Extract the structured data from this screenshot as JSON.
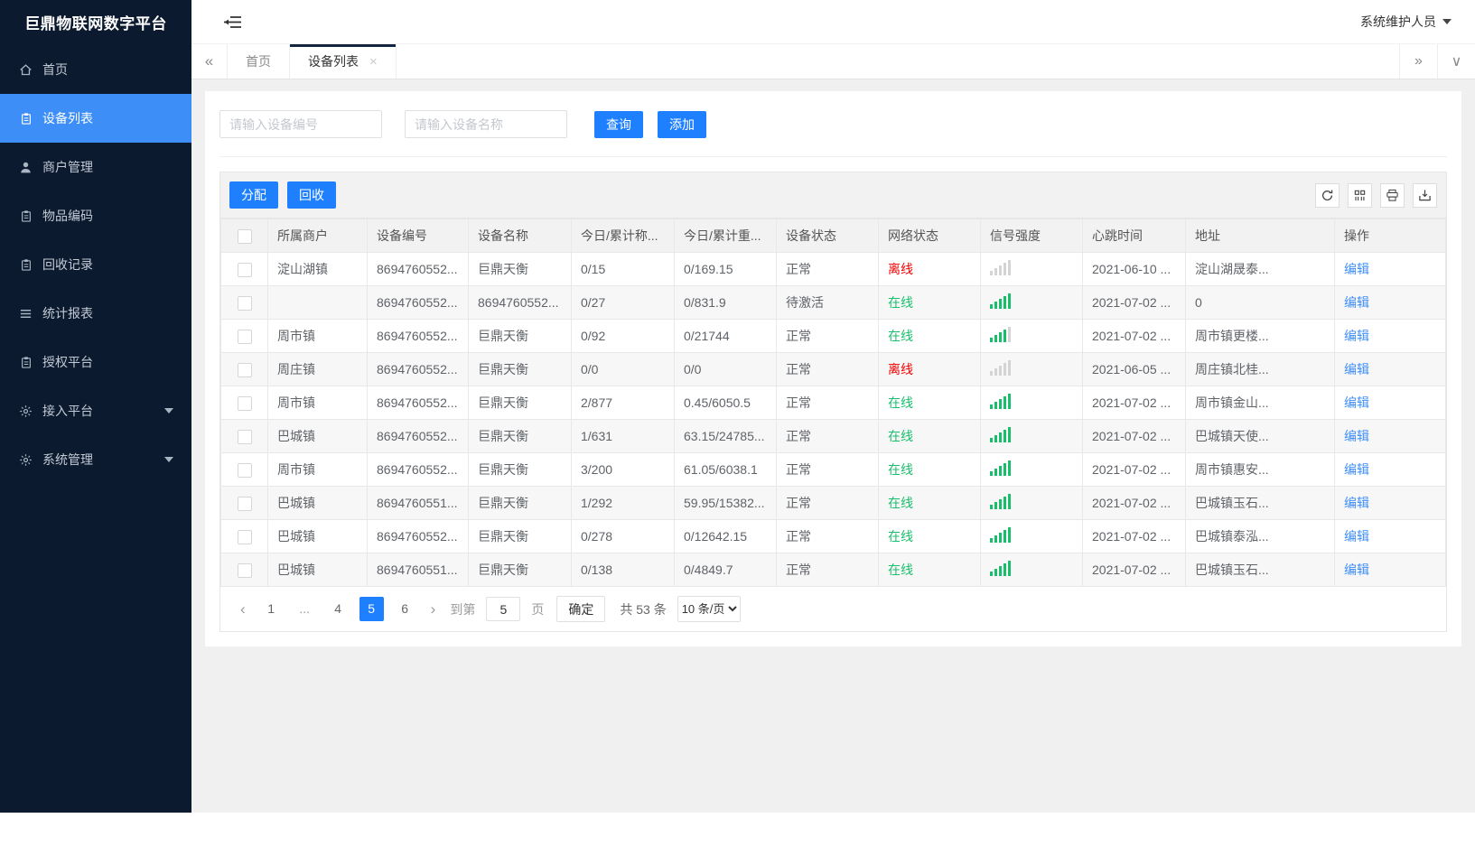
{
  "app": {
    "title": "巨鼎物联网数字平台",
    "user_name": "系统维护人员"
  },
  "icons": {
    "collapse_tabs": "«",
    "expand_tabs": "»",
    "tab_dropdown": "∨",
    "close": "×",
    "pager_prev": "‹",
    "pager_next": "›"
  },
  "sidebar": {
    "items": [
      {
        "key": "home",
        "label": "首页",
        "icon": "home",
        "active": false,
        "caret": false
      },
      {
        "key": "device-list",
        "label": "设备列表",
        "icon": "clipboard",
        "active": true,
        "caret": false
      },
      {
        "key": "merchant-mgmt",
        "label": "商户管理",
        "icon": "user",
        "active": false,
        "caret": false
      },
      {
        "key": "item-code",
        "label": "物品编码",
        "icon": "clipboard",
        "active": false,
        "caret": false
      },
      {
        "key": "recycle-records",
        "label": "回收记录",
        "icon": "clipboard",
        "active": false,
        "caret": false
      },
      {
        "key": "stats-report",
        "label": "统计报表",
        "icon": "list",
        "active": false,
        "caret": false
      },
      {
        "key": "auth-platform",
        "label": "授权平台",
        "icon": "clipboard",
        "active": false,
        "caret": false
      },
      {
        "key": "access-platform",
        "label": "接入平台",
        "icon": "gear",
        "active": false,
        "caret": true
      },
      {
        "key": "system-mgmt",
        "label": "系统管理",
        "icon": "gear",
        "active": false,
        "caret": true
      }
    ]
  },
  "tabs": {
    "items": [
      {
        "label": "首页",
        "active": false
      },
      {
        "label": "设备列表",
        "active": true,
        "closable": true
      }
    ]
  },
  "search": {
    "device_no_placeholder": "请输入设备编号",
    "device_name_placeholder": "请输入设备名称",
    "query_label": "查询",
    "add_label": "添加"
  },
  "toolbar": {
    "assign_label": "分配",
    "recycle_label": "回收",
    "icon_names": [
      "refresh-icon",
      "columns-icon",
      "print-icon",
      "export-icon"
    ]
  },
  "table": {
    "edit_label": "编辑",
    "columns": [
      "所属商户",
      "设备编号",
      "设备名称",
      "今日/累计称...",
      "今日/累计重...",
      "设备状态",
      "网络状态",
      "信号强度",
      "心跳时间",
      "地址",
      "操作"
    ],
    "rows": [
      {
        "merchant": "淀山湖镇",
        "device_no": "8694760552...",
        "device_name": "巨鼎天衡",
        "today_count": "0/15",
        "today_weight": "0/169.15",
        "device_status": "正常",
        "network_status": "离线",
        "network_state": "offline",
        "signal": "off",
        "heartbeat": "2021-06-10 ...",
        "address": "淀山湖晟泰..."
      },
      {
        "merchant": "",
        "device_no": "8694760552...",
        "device_name": "8694760552...",
        "today_count": "0/27",
        "today_weight": "0/831.9",
        "device_status": "待激活",
        "network_status": "在线",
        "network_state": "online",
        "signal": "on5",
        "heartbeat": "2021-07-02 ...",
        "address": "0"
      },
      {
        "merchant": "周市镇",
        "device_no": "8694760552...",
        "device_name": "巨鼎天衡",
        "today_count": "0/92",
        "today_weight": "0/21744",
        "device_status": "正常",
        "network_status": "在线",
        "network_state": "online",
        "signal": "on4",
        "heartbeat": "2021-07-02 ...",
        "address": "周市镇更楼..."
      },
      {
        "merchant": "周庄镇",
        "device_no": "8694760552...",
        "device_name": "巨鼎天衡",
        "today_count": "0/0",
        "today_weight": "0/0",
        "device_status": "正常",
        "network_status": "离线",
        "network_state": "offline",
        "signal": "off",
        "heartbeat": "2021-06-05 ...",
        "address": "周庄镇北桂..."
      },
      {
        "merchant": "周市镇",
        "device_no": "8694760552...",
        "device_name": "巨鼎天衡",
        "today_count": "2/877",
        "today_weight": "0.45/6050.5",
        "device_status": "正常",
        "network_status": "在线",
        "network_state": "online",
        "signal": "on5",
        "heartbeat": "2021-07-02 ...",
        "address": "周市镇金山..."
      },
      {
        "merchant": "巴城镇",
        "device_no": "8694760552...",
        "device_name": "巨鼎天衡",
        "today_count": "1/631",
        "today_weight": "63.15/24785...",
        "device_status": "正常",
        "network_status": "在线",
        "network_state": "online",
        "signal": "on5",
        "heartbeat": "2021-07-02 ...",
        "address": "巴城镇天使..."
      },
      {
        "merchant": "周市镇",
        "device_no": "8694760552...",
        "device_name": "巨鼎天衡",
        "today_count": "3/200",
        "today_weight": "61.05/6038.1",
        "device_status": "正常",
        "network_status": "在线",
        "network_state": "online",
        "signal": "on5",
        "heartbeat": "2021-07-02 ...",
        "address": "周市镇惠安..."
      },
      {
        "merchant": "巴城镇",
        "device_no": "8694760551...",
        "device_name": "巨鼎天衡",
        "today_count": "1/292",
        "today_weight": "59.95/15382...",
        "device_status": "正常",
        "network_status": "在线",
        "network_state": "online",
        "signal": "on5",
        "heartbeat": "2021-07-02 ...",
        "address": "巴城镇玉石..."
      },
      {
        "merchant": "巴城镇",
        "device_no": "8694760552...",
        "device_name": "巨鼎天衡",
        "today_count": "0/278",
        "today_weight": "0/12642.15",
        "device_status": "正常",
        "network_status": "在线",
        "network_state": "online",
        "signal": "on5",
        "heartbeat": "2021-07-02 ...",
        "address": "巴城镇泰泓..."
      },
      {
        "merchant": "巴城镇",
        "device_no": "8694760551...",
        "device_name": "巨鼎天衡",
        "today_count": "0/138",
        "today_weight": "0/4849.7",
        "device_status": "正常",
        "network_status": "在线",
        "network_state": "online",
        "signal": "on5",
        "heartbeat": "2021-07-02 ...",
        "address": "巴城镇玉石..."
      }
    ]
  },
  "pagination": {
    "pages": [
      {
        "label": "1"
      },
      {
        "label": "...",
        "ellipsis": true
      },
      {
        "label": "4"
      },
      {
        "label": "5",
        "active": true
      },
      {
        "label": "6"
      }
    ],
    "jump_label": "到第",
    "jump_value": "5",
    "page_unit_label": "页",
    "confirm_label": "确定",
    "total_label": "共 53 条",
    "page_size_options": [
      "10 条/页"
    ]
  },
  "colors": {
    "accent_blue": "#1e80ff",
    "sidebar_active_blue": "#3e8ef7",
    "online_green": "#19be6b",
    "offline_red": "#f20000",
    "link_blue": "#3e8ef7"
  }
}
